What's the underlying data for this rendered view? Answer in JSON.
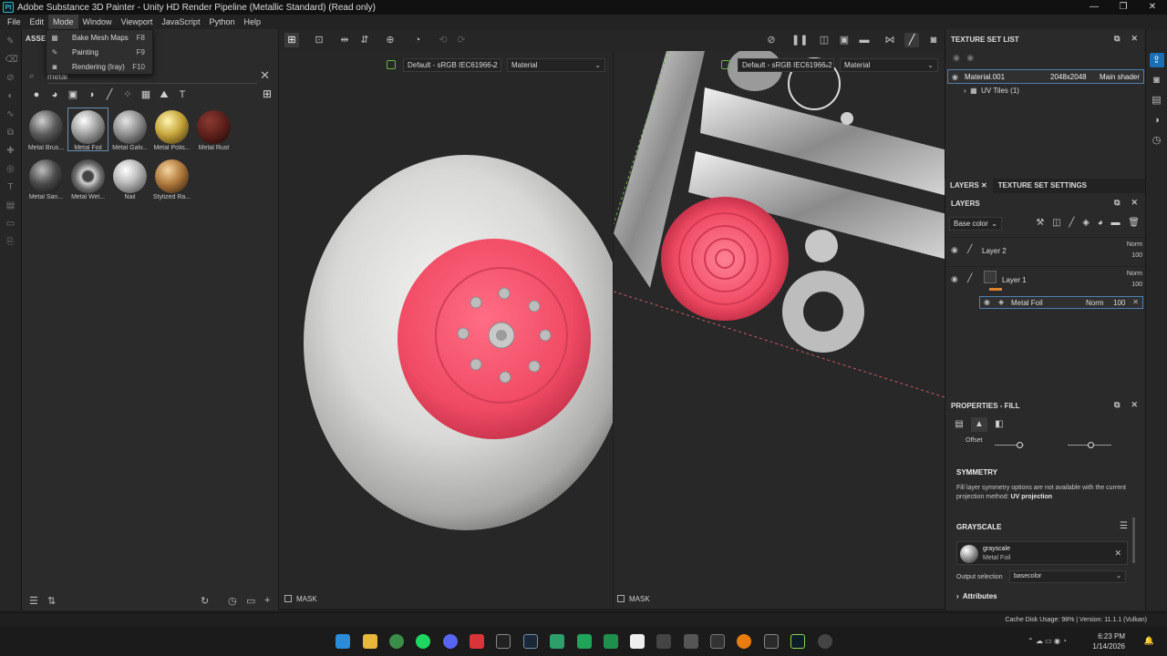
{
  "window": {
    "title": "Adobe Substance 3D Painter - Unity HD Render Pipeline (Metallic Standard) (Read only)",
    "app_icon": "Pt",
    "controls": [
      "—",
      "❐",
      "✕"
    ]
  },
  "menubar": {
    "items": [
      "File",
      "Edit",
      "Mode",
      "Window",
      "Viewport",
      "JavaScript",
      "Python",
      "Help"
    ],
    "active": "Mode"
  },
  "mode_menu": {
    "items": [
      {
        "label": "Bake Mesh Maps",
        "shortcut": "F8",
        "icon": "bake-icon"
      },
      {
        "label": "Painting",
        "shortcut": "F9",
        "icon": "brush-icon"
      },
      {
        "label": "Rendering (Iray)",
        "shortcut": "F10",
        "icon": "camera-icon"
      }
    ]
  },
  "assets": {
    "header": "ASSETS",
    "search_value": "metal",
    "items": [
      {
        "name": "Metal Brus...",
        "color": "dark-steel"
      },
      {
        "name": "Metal Foil",
        "color": "silver",
        "selected": true
      },
      {
        "name": "Metal Galv...",
        "color": "galvanized"
      },
      {
        "name": "Metal Polis...",
        "color": "gold"
      },
      {
        "name": "Metal Rust",
        "color": "rust"
      },
      {
        "name": "Metal San...",
        "color": "dark-steel"
      },
      {
        "name": "Metal Wel...",
        "color": "welded"
      },
      {
        "name": "Nail",
        "color": "silver"
      },
      {
        "name": "Stylized Ra...",
        "color": "bronze"
      }
    ]
  },
  "viewport": {
    "left": {
      "colorspace": "Default - sRGB IEC61966-2",
      "channel": "Material",
      "mask_label": "MASK"
    },
    "right": {
      "colorspace": "Default - sRGB IEC61966-2",
      "channel": "Material",
      "mask_label": "MASK"
    }
  },
  "texture_set_list": {
    "header": "TEXTURE SET LIST",
    "material": {
      "name": "Material.001",
      "resolution": "2048x2048",
      "shader": "Main shader"
    },
    "uv_tiles": "UV Tiles (1)"
  },
  "tabs": [
    "LAYERS",
    "TEXTURE SET SETTINGS"
  ],
  "layers": {
    "header": "LAYERS",
    "channel": "Base color",
    "items": [
      {
        "name": "Layer 2",
        "blend": "Norm",
        "opacity": "100"
      },
      {
        "name": "Layer 1",
        "blend": "Norm",
        "opacity": "100"
      }
    ],
    "sub_layer": {
      "name": "Metal Foil",
      "blend": "Norm",
      "opacity": "100"
    }
  },
  "properties": {
    "header": "PROPERTIES - FILL",
    "offset_label": "Offset",
    "symmetry_title": "SYMMETRY",
    "symmetry_text": "Fill layer symmetry options are not available with the current projection method:",
    "symmetry_method": "UV projection",
    "grayscale_title": "GRAYSCALE",
    "grayscale_name": "grayscale",
    "grayscale_source": "Metal Foil",
    "output_label": "Output selection",
    "output_value": "basecolor",
    "attributes_label": "Attributes"
  },
  "statusbar": {
    "text": "Cache Disk Usage:  98% | Version: 11.1.1 (Vulkan)"
  },
  "taskbar": {
    "time": "6:23 PM",
    "date": "1/14/2026"
  },
  "colors": {
    "accent": "#1c6eb4",
    "wheel_pink": "#f0506a",
    "selection": "#4c7fb0"
  }
}
